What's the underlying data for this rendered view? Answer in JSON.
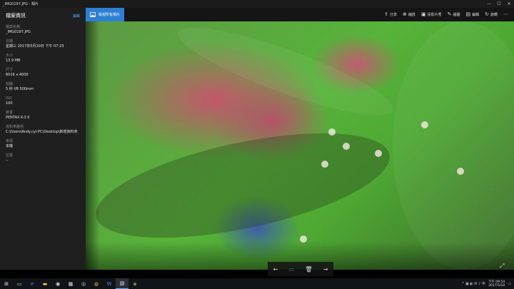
{
  "window": {
    "title": "_IMG0197.JPG - 相片",
    "minimize_icon": "—",
    "maximize_icon": "☐",
    "close_icon": "✕"
  },
  "panel": {
    "title": "檔案資訊",
    "edit_label": "編輯",
    "fields": [
      {
        "label": "檔案名稱",
        "value": "_IMG0197.JPG"
      },
      {
        "label": "日期",
        "value": "星期三 2017年5月10日 下午 07:23"
      },
      {
        "label": "大小",
        "value": "13.9 MB"
      },
      {
        "label": "尺寸",
        "value": "6016 x 4000"
      },
      {
        "label": "拍攝",
        "value": "5 秒 f/8 500mm"
      },
      {
        "label": "ISO",
        "value": "100"
      },
      {
        "label": "裝置",
        "value": "PENTAX K-3 II"
      },
      {
        "label": "資料夾路徑",
        "value": "C:\\Users\\Andy.cyl-PC\\Desktop\\新增資料夾"
      },
      {
        "label": "來源",
        "value": "本機"
      },
      {
        "label": "位置",
        "value": "--"
      }
    ]
  },
  "commandbar": {
    "view_all_label": "檢視所有相片",
    "commands": [
      {
        "name": "share",
        "icon": "⇪",
        "label": "分享"
      },
      {
        "name": "zoom",
        "icon": "⊕",
        "label": "縮放"
      },
      {
        "name": "slideshow",
        "icon": "▣",
        "label": "投影片秀"
      },
      {
        "name": "draw",
        "icon": "✎",
        "label": "繪圖"
      },
      {
        "name": "edit",
        "icon": "▤",
        "label": "編輯"
      },
      {
        "name": "rotate",
        "icon": "↻",
        "label": "旋轉"
      },
      {
        "name": "more",
        "icon": "⋯",
        "label": ""
      }
    ]
  },
  "nav": {
    "prev_icon": "←",
    "info_icon": "▭",
    "delete_icon": "🗑",
    "next_icon": "→",
    "fullscreen_icon": "⤢"
  },
  "taskbar": {
    "items": [
      {
        "name": "start",
        "icon": "⊞"
      },
      {
        "name": "task-view",
        "icon": "▭"
      },
      {
        "name": "edge",
        "icon": "e"
      },
      {
        "name": "file-explorer",
        "icon": "▬"
      },
      {
        "name": "app-1",
        "icon": "◉"
      },
      {
        "name": "calculator",
        "icon": "▦"
      },
      {
        "name": "app-2",
        "icon": "◎"
      },
      {
        "name": "chrome",
        "icon": "◍"
      },
      {
        "name": "word",
        "icon": "W"
      },
      {
        "name": "photos",
        "icon": "▧"
      },
      {
        "name": "app-3",
        "icon": "◈"
      }
    ],
    "tray_icons": "^ ▣ ◐ ✉ ♪ 中",
    "time": "下午 09:54",
    "date": "2017/5/10"
  },
  "colors": {
    "accent": "#2d7fd3",
    "panel_bg": "#1f1f1f",
    "link": "#4aa3ff"
  }
}
